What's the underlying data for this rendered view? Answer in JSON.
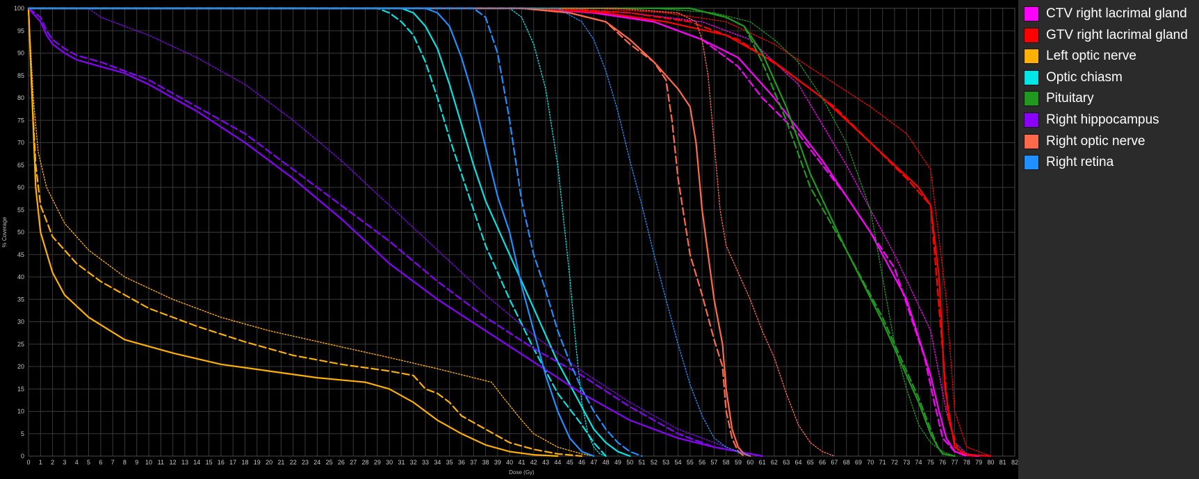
{
  "chart_data": {
    "type": "line",
    "xlabel": "Dose (Gy)",
    "ylabel": "% Coverage",
    "xlim": [
      0,
      82
    ],
    "ylim": [
      0,
      100
    ],
    "x_ticks": [
      "0",
      "1",
      "2",
      "3",
      "4",
      "5",
      "6",
      "7",
      "8",
      "9",
      "10",
      "11",
      "12",
      "13",
      "14",
      "15",
      "16",
      "17",
      "18",
      "19",
      "20",
      "21",
      "22",
      "23",
      "24",
      "25",
      "26",
      "27",
      "28",
      "29",
      "30",
      "31",
      "32",
      "33",
      "34",
      "35",
      "36",
      "37",
      "38",
      "39",
      "40",
      "41",
      "42",
      "43",
      "44",
      "45",
      "46",
      "47",
      "48",
      "49",
      "50",
      "51",
      "52",
      "53",
      "54",
      "55",
      "56",
      "57",
      "58",
      "59",
      "60",
      "61",
      "62",
      "63",
      "64",
      "65",
      "66",
      "67",
      "68",
      "69",
      "70",
      "71",
      "72",
      "73",
      "74",
      "75",
      "76",
      "77",
      "78",
      "79",
      "80",
      "81",
      "82"
    ],
    "y_ticks": [
      "0",
      "5",
      "10",
      "15",
      "20",
      "25",
      "30",
      "35",
      "40",
      "45",
      "50",
      "55",
      "60",
      "65",
      "70",
      "75",
      "80",
      "85",
      "90",
      "95",
      "100"
    ],
    "grid": true,
    "legend_position": "right",
    "legend": [
      {
        "name": "CTV right lacrimal gland",
        "color": "#ff00ff"
      },
      {
        "name": "GTV right lacrimal gland",
        "color": "#ff0000"
      },
      {
        "name": "Left optic nerve",
        "color": "#ffb000"
      },
      {
        "name": "Optic chiasm",
        "color": "#00e5e5"
      },
      {
        "name": "Pituitary",
        "color": "#1f9a1f"
      },
      {
        "name": "Right hippocampus",
        "color": "#8a00ff"
      },
      {
        "name": "Right optic nerve",
        "color": "#ff6a4d"
      },
      {
        "name": "Right retina",
        "color": "#1e90ff"
      }
    ],
    "series": [
      {
        "legend": "CTV right lacrimal gland",
        "color": "#ff00ff",
        "style": "solid",
        "x": [
          0,
          42,
          47,
          52,
          56,
          59,
          62,
          66,
          70,
          73,
          75,
          75.7,
          76.3,
          77,
          78,
          79
        ],
        "y": [
          100,
          100,
          99,
          97,
          93,
          89,
          80,
          66,
          50,
          35,
          18,
          10,
          4,
          1,
          0.2,
          0
        ]
      },
      {
        "legend": "CTV right lacrimal gland",
        "color": "#ff00ff",
        "style": "dashed",
        "x": [
          0,
          42,
          47,
          52,
          56,
          59,
          61,
          64,
          68,
          72,
          74.5,
          75.3,
          76,
          77,
          78
        ],
        "y": [
          100,
          100,
          99,
          97,
          93,
          87,
          80,
          72,
          58,
          42,
          22,
          12,
          4,
          1,
          0
        ]
      },
      {
        "legend": "CTV right lacrimal gland",
        "color": "#ff00ff",
        "style": "dotted",
        "x": [
          0,
          44,
          50,
          56,
          60,
          64,
          68,
          72,
          75,
          76.3,
          77,
          78,
          79.5
        ],
        "y": [
          100,
          100,
          99,
          97,
          93,
          83,
          65,
          45,
          28,
          10,
          3,
          0.5,
          0
        ]
      },
      {
        "legend": "GTV right lacrimal gland",
        "color": "#ff0000",
        "style": "solid",
        "x": [
          0,
          42,
          48,
          53,
          58,
          62,
          66,
          70,
          72,
          74,
          75,
          75.7,
          76.2,
          77,
          78,
          80
        ],
        "y": [
          100,
          100,
          99,
          97,
          94,
          88,
          80,
          70,
          65,
          60,
          56,
          40,
          15,
          2,
          0.3,
          0
        ]
      },
      {
        "legend": "GTV right lacrimal gland",
        "color": "#ff0000",
        "style": "dashed",
        "x": [
          0,
          44,
          50,
          55,
          59,
          63,
          67,
          70,
          73,
          75,
          75.8,
          76.5,
          77.3,
          78.5
        ],
        "y": [
          100,
          100,
          99,
          97,
          93,
          86,
          78,
          70,
          62,
          56,
          30,
          8,
          1,
          0
        ]
      },
      {
        "legend": "GTV right lacrimal gland",
        "color": "#ff0000",
        "style": "dotted",
        "x": [
          0,
          47,
          53,
          58,
          62,
          66,
          70,
          73,
          75,
          76.3,
          77,
          78,
          80
        ],
        "y": [
          100,
          100,
          99,
          97,
          92,
          85,
          78,
          72,
          64,
          35,
          10,
          2,
          0
        ]
      },
      {
        "legend": "Left optic nerve",
        "color": "#ffb000",
        "style": "solid",
        "x": [
          0,
          0.3,
          0.6,
          1,
          2,
          3,
          5,
          8,
          12,
          16,
          20,
          24,
          28,
          30,
          32,
          34,
          36,
          38,
          40,
          42,
          44
        ],
        "y": [
          100,
          80,
          60,
          50,
          41,
          36,
          31,
          26,
          23,
          20.5,
          19,
          17.5,
          16.5,
          15,
          12,
          8,
          5,
          2.5,
          1,
          0.3,
          0
        ]
      },
      {
        "legend": "Left optic nerve",
        "color": "#ffb000",
        "style": "dashed",
        "x": [
          0,
          0.3,
          0.6,
          1,
          2,
          4,
          6,
          8,
          10,
          14,
          18,
          22,
          26,
          30,
          32,
          33,
          34,
          35,
          36,
          38,
          40,
          42,
          44,
          46
        ],
        "y": [
          100,
          80,
          65,
          56,
          49,
          43,
          39,
          36,
          33,
          29,
          25.5,
          22.5,
          20.5,
          19,
          18,
          15,
          14,
          12,
          9,
          6,
          3,
          1.5,
          0.5,
          0
        ]
      },
      {
        "legend": "Left optic nerve",
        "color": "#ffb000",
        "style": "dotted",
        "x": [
          0,
          0.4,
          0.8,
          1.5,
          3,
          5,
          8,
          12,
          16,
          20,
          25,
          30,
          34,
          37,
          38.5,
          39.5,
          41,
          42,
          44,
          46,
          47
        ],
        "y": [
          100,
          80,
          68,
          60,
          52,
          46,
          40,
          35,
          31,
          28,
          25,
          22,
          19.5,
          17.5,
          16.5,
          13,
          8,
          5,
          2,
          0.5,
          0
        ]
      },
      {
        "legend": "Optic chiasm",
        "color": "#00e5e5",
        "style": "solid",
        "x": [
          0,
          31,
          32,
          33,
          34,
          35,
          36,
          37,
          38,
          40,
          42,
          44,
          46,
          47,
          48,
          49,
          50
        ],
        "y": [
          100,
          100,
          99,
          96,
          91,
          83,
          74,
          65,
          57,
          45,
          33,
          21,
          11,
          6,
          3,
          1,
          0
        ]
      },
      {
        "legend": "Optic chiasm",
        "color": "#00e5e5",
        "style": "dashed",
        "x": [
          0,
          29,
          30,
          31,
          32,
          33,
          34,
          35,
          36,
          37,
          38,
          40,
          42,
          44,
          46,
          47,
          48
        ],
        "y": [
          100,
          100,
          99,
          97,
          94,
          88,
          80,
          71,
          63,
          55,
          47,
          35,
          24,
          14,
          7,
          3,
          0
        ]
      },
      {
        "legend": "Optic chiasm",
        "color": "#00e5e5",
        "style": "dotted",
        "x": [
          0,
          40,
          41,
          42,
          43,
          44,
          45,
          45.5,
          46,
          46.5,
          47,
          47.5,
          48
        ],
        "y": [
          100,
          100,
          98,
          92,
          82,
          65,
          40,
          25,
          12,
          5,
          2,
          0.5,
          0
        ]
      },
      {
        "legend": "Pituitary",
        "color": "#1f9a1f",
        "style": "solid",
        "x": [
          0,
          50,
          55,
          58,
          59.5,
          61,
          63,
          65,
          68,
          71,
          74,
          75,
          75.6,
          76,
          77
        ],
        "y": [
          100,
          100,
          100,
          98,
          96,
          90,
          78,
          63,
          46,
          30,
          12,
          5,
          2,
          0.5,
          0
        ]
      },
      {
        "legend": "Pituitary",
        "color": "#1f9a1f",
        "style": "dashed",
        "x": [
          0,
          50,
          55,
          58,
          59.5,
          61,
          63,
          65,
          68,
          71,
          74,
          75,
          75.6,
          76,
          77
        ],
        "y": [
          100,
          100,
          100,
          98,
          96,
          88,
          75,
          60,
          46,
          31,
          13,
          6,
          2,
          0.5,
          0
        ]
      },
      {
        "legend": "Pituitary",
        "color": "#1f9a1f",
        "style": "dotted",
        "x": [
          0,
          52,
          57,
          60,
          62,
          64,
          66,
          68,
          70,
          71,
          72,
          73,
          74,
          75,
          76,
          77
        ],
        "y": [
          100,
          100,
          99,
          97,
          93,
          88,
          80,
          70,
          55,
          40,
          25,
          15,
          7,
          3,
          1,
          0
        ]
      },
      {
        "legend": "Right hippocampus",
        "color": "#8a00ff",
        "style": "solid",
        "x": [
          0,
          1,
          1.5,
          2,
          3,
          4,
          6,
          8,
          10,
          14,
          18,
          22,
          26,
          30,
          34,
          38,
          42,
          46,
          50,
          54,
          57,
          59,
          61
        ],
        "y": [
          100,
          97,
          94,
          92,
          90,
          88.5,
          87,
          85.5,
          83,
          77,
          70,
          62,
          53,
          43,
          35,
          28,
          21,
          14,
          8,
          4,
          2,
          1,
          0
        ]
      },
      {
        "legend": "Right hippocampus",
        "color": "#8a00ff",
        "style": "dashed",
        "x": [
          0,
          1,
          1.5,
          2,
          3,
          4,
          6,
          8,
          10,
          14,
          18,
          22,
          26,
          30,
          34,
          38,
          42,
          46,
          50,
          54,
          57,
          59,
          61
        ],
        "y": [
          100,
          98,
          95,
          93,
          91,
          89.5,
          88,
          86,
          84,
          78,
          72,
          64,
          56,
          48,
          39,
          31,
          24,
          18,
          11,
          5,
          2,
          1,
          0
        ]
      },
      {
        "legend": "Right hippocampus",
        "color": "#8a00ff",
        "style": "dotted",
        "x": [
          0,
          5,
          6,
          8,
          10,
          14,
          18,
          22,
          26,
          30,
          34,
          38,
          42,
          46,
          50,
          54,
          57,
          59,
          60
        ],
        "y": [
          100,
          100,
          98,
          96,
          94,
          89,
          83,
          75,
          66,
          56,
          46,
          36,
          27,
          19,
          12,
          6,
          3,
          1,
          0
        ]
      },
      {
        "legend": "Right optic nerve",
        "color": "#ff6a4d",
        "style": "solid",
        "x": [
          0,
          41,
          45,
          48,
          50,
          52,
          54,
          55,
          55.5,
          56,
          57,
          57.7,
          58,
          58.5,
          59,
          59.5,
          60
        ],
        "y": [
          100,
          100,
          99,
          97,
          93,
          88,
          82,
          78,
          70,
          55,
          35,
          25,
          15,
          6,
          2,
          0.5,
          0
        ]
      },
      {
        "legend": "Right optic nerve",
        "color": "#ff6a4d",
        "style": "dashed",
        "x": [
          0,
          41,
          45,
          48,
          50,
          52,
          53,
          53.5,
          54,
          55,
          56,
          57,
          57.7,
          58,
          58.5,
          59,
          59.5
        ],
        "y": [
          100,
          100,
          99,
          97,
          92,
          88,
          84,
          75,
          62,
          45,
          36,
          26,
          20,
          10,
          4,
          1,
          0
        ]
      },
      {
        "legend": "Right optic nerve",
        "color": "#ff6a4d",
        "style": "dotted",
        "x": [
          0,
          49,
          54,
          55.5,
          56,
          56.5,
          57,
          57.5,
          58,
          59,
          60,
          61,
          62,
          63,
          64,
          65,
          66,
          67
        ],
        "y": [
          100,
          100,
          99,
          97,
          93,
          85,
          70,
          55,
          47,
          41,
          35,
          28,
          22,
          14,
          7,
          3,
          1,
          0
        ]
      },
      {
        "legend": "Right retina",
        "color": "#1e90ff",
        "style": "solid",
        "x": [
          0,
          33,
          34,
          35,
          36,
          37,
          38,
          39,
          40,
          41,
          42,
          43,
          44,
          45,
          46,
          47
        ],
        "y": [
          100,
          100,
          99,
          96,
          89,
          80,
          69,
          58,
          50,
          38,
          28,
          18,
          10,
          4,
          1,
          0
        ]
      },
      {
        "legend": "Right retina",
        "color": "#1e90ff",
        "style": "dashed",
        "x": [
          0,
          37,
          38,
          39,
          40,
          41,
          42,
          43,
          44,
          45,
          46,
          47,
          48,
          49,
          50,
          51
        ],
        "y": [
          100,
          100,
          98,
          90,
          75,
          57,
          45,
          37,
          28,
          21,
          15,
          10,
          6,
          3,
          1,
          0
        ]
      },
      {
        "legend": "Right retina",
        "color": "#1e90ff",
        "style": "dotted",
        "x": [
          0,
          44,
          46,
          47,
          48,
          49,
          50,
          51,
          52,
          53,
          54,
          55,
          56,
          57,
          58,
          59,
          60
        ],
        "y": [
          100,
          100,
          97,
          93,
          86,
          77,
          66,
          56,
          45,
          35,
          25,
          16,
          9,
          4,
          2,
          1,
          0
        ]
      }
    ]
  }
}
